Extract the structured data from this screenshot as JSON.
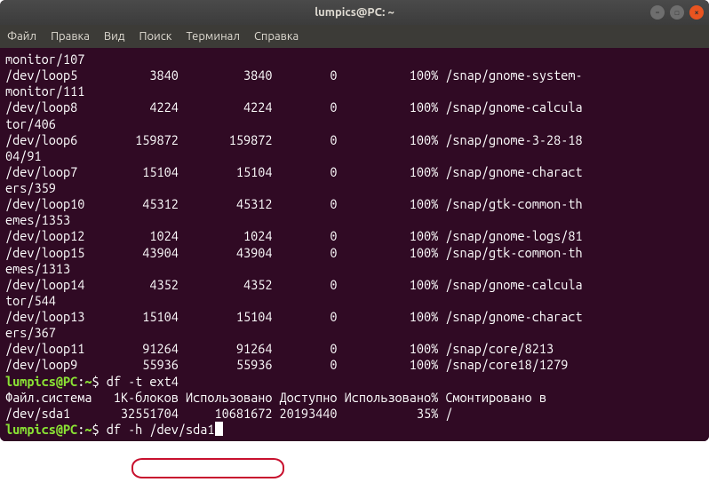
{
  "titlebar": {
    "title": "lumpics@PC: ~"
  },
  "menubar": {
    "items": [
      {
        "label": "Файл"
      },
      {
        "label": "Правка"
      },
      {
        "label": "Вид"
      },
      {
        "label": "Поиск"
      },
      {
        "label": "Терминал"
      },
      {
        "label": "Справка"
      }
    ]
  },
  "output": {
    "rows": [
      {
        "fs": "monitor/107",
        "blocks": "",
        "used": "",
        "avail": "",
        "pct": "",
        "mnt": "",
        "wrap": true
      },
      {
        "fs": "/dev/loop5",
        "blocks": "3840",
        "used": "3840",
        "avail": "0",
        "pct": "100%",
        "mnt": "/snap/gnome-system-",
        "cont": "monitor/111"
      },
      {
        "fs": "/dev/loop8",
        "blocks": "4224",
        "used": "4224",
        "avail": "0",
        "pct": "100%",
        "mnt": "/snap/gnome-calcula",
        "cont": "tor/406"
      },
      {
        "fs": "/dev/loop6",
        "blocks": "159872",
        "used": "159872",
        "avail": "0",
        "pct": "100%",
        "mnt": "/snap/gnome-3-28-18",
        "cont": "04/91"
      },
      {
        "fs": "/dev/loop7",
        "blocks": "15104",
        "used": "15104",
        "avail": "0",
        "pct": "100%",
        "mnt": "/snap/gnome-charact",
        "cont": "ers/359"
      },
      {
        "fs": "/dev/loop10",
        "blocks": "45312",
        "used": "45312",
        "avail": "0",
        "pct": "100%",
        "mnt": "/snap/gtk-common-th",
        "cont": "emes/1353"
      },
      {
        "fs": "/dev/loop12",
        "blocks": "1024",
        "used": "1024",
        "avail": "0",
        "pct": "100%",
        "mnt": "/snap/gnome-logs/81"
      },
      {
        "fs": "/dev/loop15",
        "blocks": "43904",
        "used": "43904",
        "avail": "0",
        "pct": "100%",
        "mnt": "/snap/gtk-common-th",
        "cont": "emes/1313"
      },
      {
        "fs": "/dev/loop14",
        "blocks": "4352",
        "used": "4352",
        "avail": "0",
        "pct": "100%",
        "mnt": "/snap/gnome-calcula",
        "cont": "tor/544"
      },
      {
        "fs": "/dev/loop13",
        "blocks": "15104",
        "used": "15104",
        "avail": "0",
        "pct": "100%",
        "mnt": "/snap/gnome-charact",
        "cont": "ers/367"
      },
      {
        "fs": "/dev/loop11",
        "blocks": "91264",
        "used": "91264",
        "avail": "0",
        "pct": "100%",
        "mnt": "/snap/core/8213"
      },
      {
        "fs": "/dev/loop9",
        "blocks": "55936",
        "used": "55936",
        "avail": "0",
        "pct": "100%",
        "mnt": "/snap/core18/1279"
      }
    ]
  },
  "prompt1": {
    "user_host": "lumpics@PC",
    "colon": ":",
    "path": "~",
    "dollar": "$ ",
    "command": "df -t ext4"
  },
  "header": {
    "fs": "Файл.система",
    "blocks": "1K-блоков",
    "used": "Использовано",
    "avail": "Доступно",
    "pct": "Использовано%",
    "mnt": "Cмонтировано в"
  },
  "ext4row": {
    "fs": "/dev/sda1",
    "blocks": "32551704",
    "used": "10681672",
    "avail": "20193440",
    "pct": "35%",
    "mnt": "/"
  },
  "prompt2": {
    "user_host": "lumpics@PC",
    "colon": ":",
    "path": "~",
    "dollar": "$ ",
    "command": "df -h /dev/sda1"
  }
}
